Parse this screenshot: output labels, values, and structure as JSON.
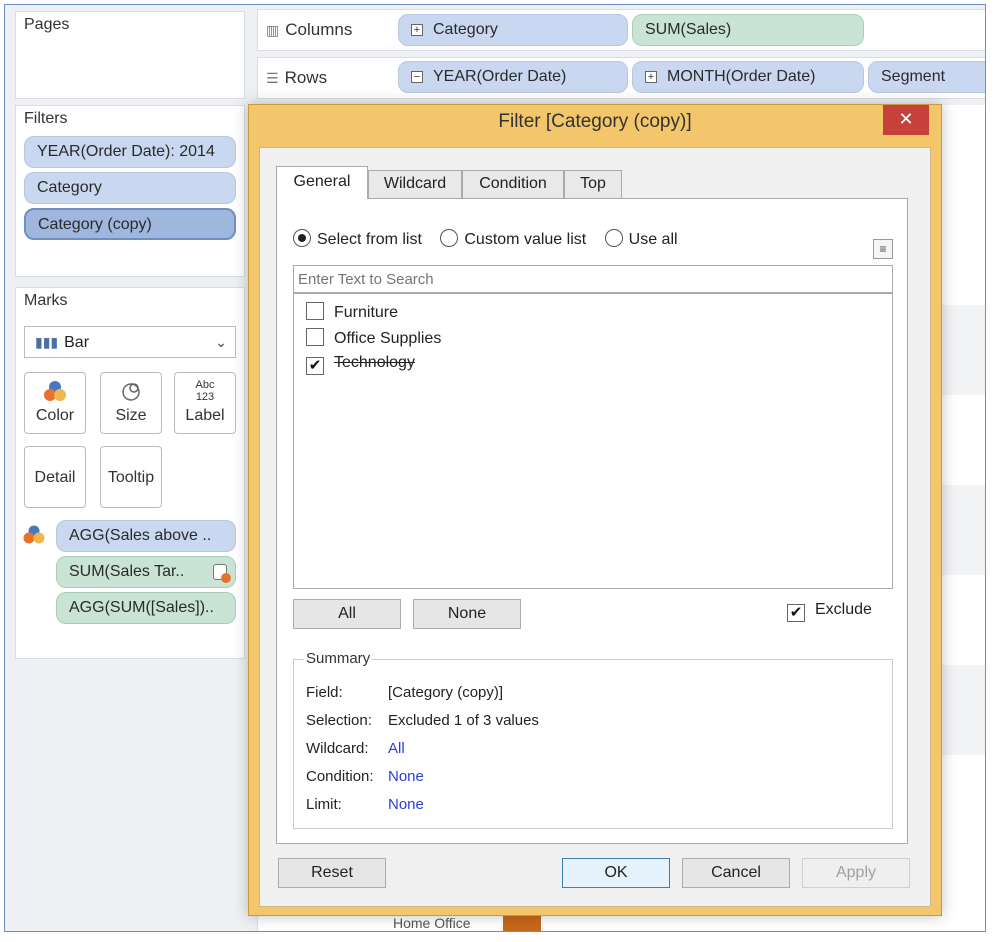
{
  "pages": {
    "title": "Pages"
  },
  "filters": {
    "title": "Filters",
    "items": [
      "YEAR(Order Date): 2014",
      "Category",
      "Category (copy)"
    ]
  },
  "marks": {
    "title": "Marks",
    "type": "Bar",
    "buttons": {
      "color": "Color",
      "size": "Size",
      "label": "Label",
      "label_icon": "Abc 123",
      "detail": "Detail",
      "tooltip": "Tooltip"
    },
    "fields": [
      "AGG(Sales above ..",
      "SUM(Sales Tar..",
      "AGG(SUM([Sales]).."
    ]
  },
  "shelves": {
    "columns_label": "Columns",
    "columns": [
      "Category",
      "SUM(Sales)"
    ],
    "rows_label": "Rows",
    "rows": [
      "YEAR(Order Date)",
      "MONTH(Order Date)",
      "Segment"
    ]
  },
  "canvas": {
    "bottom_label": "Home Office"
  },
  "dialog": {
    "title": "Filter [Category (copy)]",
    "close": "✕",
    "tabs": [
      "General",
      "Wildcard",
      "Condition",
      "Top"
    ],
    "radios": [
      "Select from list",
      "Custom value list",
      "Use all"
    ],
    "search_placeholder": "Enter Text to Search",
    "items": [
      {
        "label": "Furniture",
        "checked": false
      },
      {
        "label": "Office Supplies",
        "checked": false
      },
      {
        "label": "Technology",
        "checked": true
      }
    ],
    "all_button": "All",
    "none_button": "None",
    "exclude_label": "Exclude",
    "summary": {
      "title": "Summary",
      "field_k": "Field:",
      "field_v": "[Category (copy)]",
      "selection_k": "Selection:",
      "selection_v": "Excluded 1 of 3 values",
      "wildcard_k": "Wildcard:",
      "wildcard_v": "All",
      "condition_k": "Condition:",
      "condition_v": "None",
      "limit_k": "Limit:",
      "limit_v": "None"
    },
    "buttons": {
      "reset": "Reset",
      "ok": "OK",
      "cancel": "Cancel",
      "apply": "Apply"
    }
  }
}
